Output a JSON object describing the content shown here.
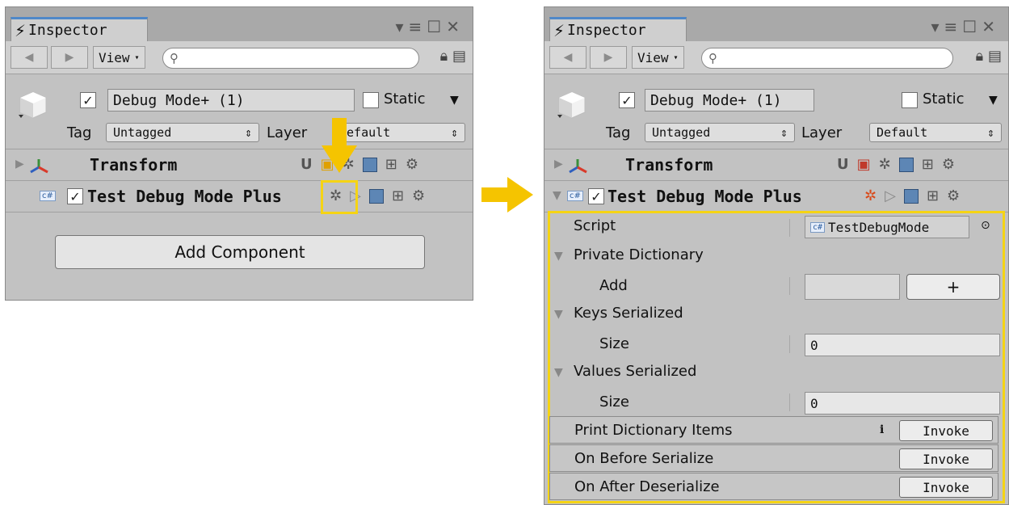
{
  "colors": {
    "highlight": "#f5d414",
    "panel_bg": "#c2c2c2",
    "tab_accent": "#4f88c8"
  },
  "before": {
    "tab_title": "Inspector",
    "toolbar": {
      "view_label": "View",
      "search_placeholder": ""
    },
    "gameobject": {
      "active": true,
      "name": "Debug Mode+ (1)",
      "static_label": "Static",
      "tag_label": "Tag",
      "tag_value": "Untagged",
      "layer_label": "Layer",
      "layer_value": "Default"
    },
    "components": [
      {
        "title": "Transform"
      },
      {
        "title": "Test Debug Mode Plus",
        "enabled": true
      }
    ],
    "add_component_label": "Add Component"
  },
  "after": {
    "tab_title": "Inspector",
    "toolbar": {
      "view_label": "View",
      "search_placeholder": ""
    },
    "gameobject": {
      "active": true,
      "name": "Debug Mode+ (1)",
      "static_label": "Static",
      "tag_label": "Tag",
      "tag_value": "Untagged",
      "layer_label": "Layer",
      "layer_value": "Default"
    },
    "components": [
      {
        "title": "Transform"
      },
      {
        "title": "Test Debug Mode Plus",
        "enabled": true
      }
    ],
    "fields": {
      "script_label": "Script",
      "script_value": "TestDebugMode",
      "private_dictionary_label": "Private Dictionary",
      "add_label": "Add",
      "plus_label": "+",
      "keys_serialized_label": "Keys Serialized",
      "keys_size_label": "Size",
      "keys_size_value": "0",
      "values_serialized_label": "Values Serialized",
      "values_size_label": "Size",
      "values_size_value": "0"
    },
    "methods": [
      {
        "label": "Print Dictionary Items",
        "button": "Invoke",
        "info": "i"
      },
      {
        "label": "On Before Serialize",
        "button": "Invoke"
      },
      {
        "label": "On After Deserialize",
        "button": "Invoke"
      }
    ]
  }
}
